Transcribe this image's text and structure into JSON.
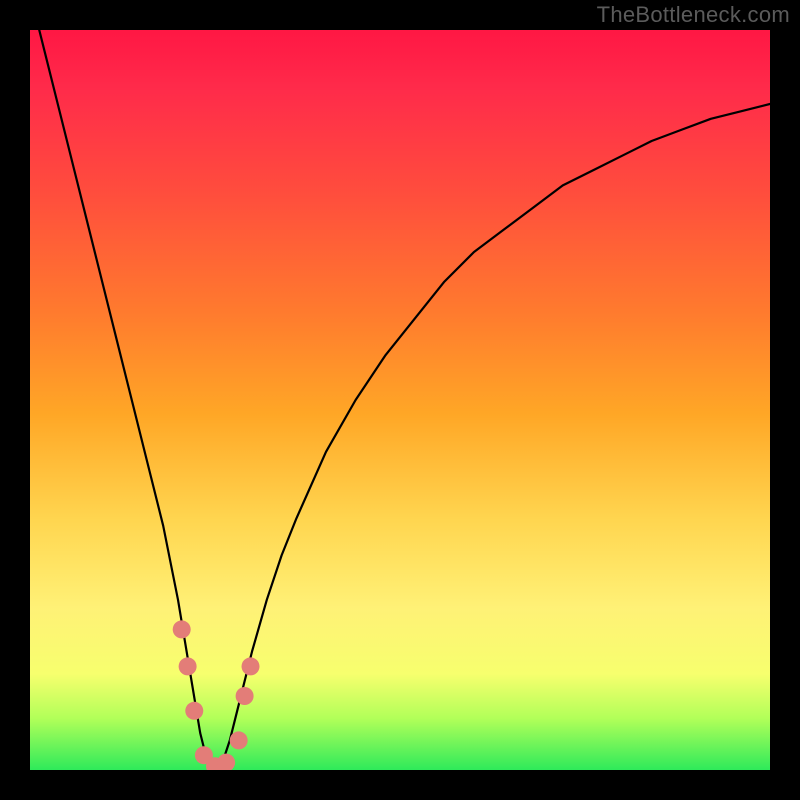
{
  "watermark": "TheBottleneck.com",
  "colors": {
    "frame": "#000000",
    "gradient_top": "#ff1744",
    "gradient_mid_orange": "#ff7a2e",
    "gradient_mid_yellow": "#ffd54f",
    "gradient_bottom": "#2eea5a",
    "curve": "#000000",
    "markers": "#e37d78"
  },
  "chart_data": {
    "type": "line",
    "title": "",
    "xlabel": "",
    "ylabel": "",
    "xlim": [
      0,
      100
    ],
    "ylim": [
      0,
      100
    ],
    "x": [
      0,
      2,
      4,
      6,
      8,
      10,
      12,
      14,
      16,
      18,
      20,
      21,
      22,
      23,
      24,
      25,
      26,
      27,
      28,
      30,
      32,
      34,
      36,
      40,
      44,
      48,
      52,
      56,
      60,
      64,
      68,
      72,
      76,
      80,
      84,
      88,
      92,
      96,
      100
    ],
    "series": [
      {
        "name": "bottleneck-curve",
        "values": [
          105,
          97,
          89,
          81,
          73,
          65,
          57,
          49,
          41,
          33,
          23,
          17,
          11,
          5,
          1,
          0,
          1,
          4,
          8,
          16,
          23,
          29,
          34,
          43,
          50,
          56,
          61,
          66,
          70,
          73,
          76,
          79,
          81,
          83,
          85,
          86.5,
          88,
          89,
          90
        ]
      }
    ],
    "markers": {
      "name": "highlight-points",
      "points": [
        {
          "x": 20.5,
          "y": 19
        },
        {
          "x": 21.3,
          "y": 14
        },
        {
          "x": 22.2,
          "y": 8
        },
        {
          "x": 23.5,
          "y": 2
        },
        {
          "x": 25.0,
          "y": 0.5
        },
        {
          "x": 26.5,
          "y": 1
        },
        {
          "x": 28.2,
          "y": 4
        },
        {
          "x": 29.0,
          "y": 10
        },
        {
          "x": 29.8,
          "y": 14
        }
      ]
    }
  }
}
